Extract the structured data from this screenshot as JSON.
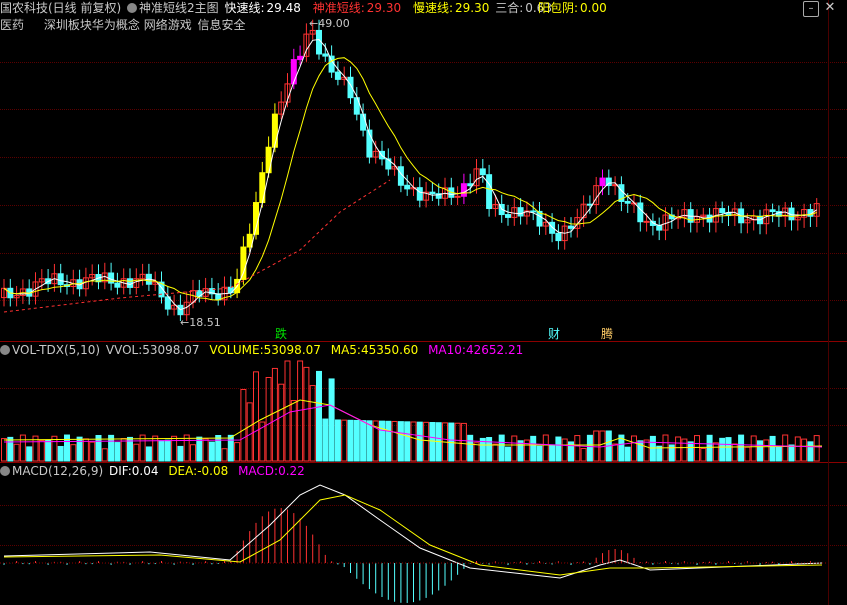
{
  "header": {
    "title": "国农科技(日线 前复权)",
    "indicator_name": "神准短线2主图",
    "fast_label": "快速线:",
    "fast_value": "29.48",
    "shen_label": "神准短线:",
    "shen_value": "29.30",
    "slow_label": "慢速线:",
    "slow_value": "29.30",
    "sanhe_label": "三合:",
    "sanhe_value": "0.63",
    "yang_label": "阳包阴:",
    "yang_value": "0.00"
  },
  "concepts": [
    "医药",
    "深圳板块",
    "华为概念",
    "网络游戏",
    "信息安全"
  ],
  "main_chart": {
    "high_label": "49.00",
    "low_label": "18.51",
    "markers": {
      "die": "跌",
      "cai": "财",
      "teng": "腾"
    }
  },
  "vol_panel": {
    "name": "VOL-TDX(5,10)",
    "vvol_label": "VVOL:",
    "vvol_value": "53098.07",
    "volume_label": "VOLUME:",
    "volume_value": "53098.07",
    "ma5_label": "MA5:",
    "ma5_value": "45350.60",
    "ma10_label": "MA10:",
    "ma10_value": "42652.21"
  },
  "macd_panel": {
    "name": "MACD(12,26,9)",
    "dif_label": "DIF:",
    "dif_value": "0.04",
    "dea_label": "DEA:",
    "dea_value": "-0.08",
    "macd_label": "MACD:",
    "macd_value": "0.22"
  },
  "colors": {
    "up": "#ff3232",
    "down": "#54ffff",
    "yellow": "#ffff00",
    "magenta": "#ff00ff",
    "white": "#ffffff",
    "green": "#00e000"
  },
  "icons": {
    "title_toggle": "circle-icon",
    "window_buttons": [
      "minimize-icon",
      "maximize-icon",
      "close-icon"
    ]
  }
}
